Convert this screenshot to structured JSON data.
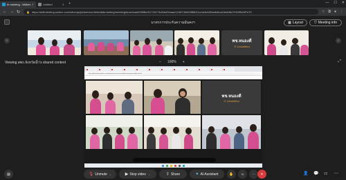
{
  "browser": {
    "tabs": [
      {
        "label": "In meeting - Webex - Webex",
        "active": true
      },
      {
        "label": "Untitled",
        "active": false
      }
    ],
    "url": "https://ddkmeeting.webex.com/wbxmjs/joinservice/sites/ddkmeeting/meeting/download/0358be51715174cfbbd34aaa/1248749d94ff8810cc4a3eb30adbdfca16e8d8c7040f9b5ff7e79"
  },
  "meeting": {
    "title": "มาตรการประกันความมั่นคงฯ",
    "layout_label": "Layout",
    "info_label": "Meeting info"
  },
  "filmstrip": {
    "unverified_name": "พช.หนองดี",
    "unverified_status": "Unverified"
  },
  "share": {
    "label": "Viewing สพร.จังหวัดน้ำ's shared content",
    "zoom": "100%",
    "zoom_minus": "−",
    "zoom_plus": "+",
    "inner_url": "https://ddkmeeting.webex.com/wbxmjs/joinservice/sites/ddkmeeting/meeting/download",
    "unverified_name": "พช.หนองดี",
    "unverified_status": "Unverified"
  },
  "controls": {
    "unmute": "Unmute",
    "stop_video": "Stop video",
    "share": "Share",
    "ai_assistant": "AI Assistant"
  },
  "colors": {
    "leave": "#d83b3b",
    "unverified": "#e6a23c",
    "background": "#1e1e1e"
  }
}
